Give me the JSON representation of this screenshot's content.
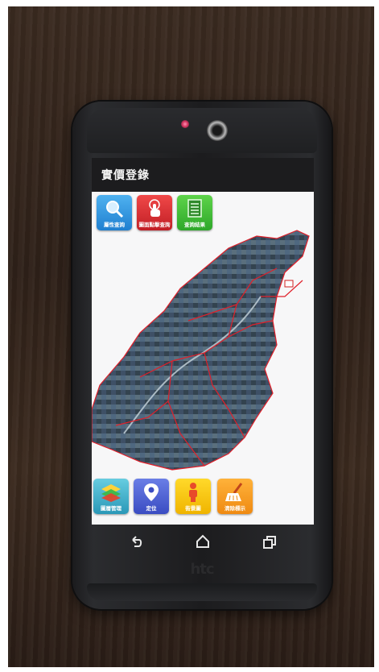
{
  "app": {
    "title": "實價登錄"
  },
  "top_buttons": [
    {
      "label": "屬性查詢",
      "icon": "magnifier-icon",
      "color": "#2e8fdf"
    },
    {
      "label": "圖面點擊查詢",
      "icon": "tap-hand-icon",
      "color": "#d62a30"
    },
    {
      "label": "查詢結果",
      "icon": "list-document-icon",
      "color": "#3fbf36"
    }
  ],
  "bottom_buttons": [
    {
      "label": "圖層管理",
      "icon": "layers-icon",
      "color": "#3fb0cc"
    },
    {
      "label": "定位",
      "icon": "map-pin-icon",
      "color": "#4a5fd6"
    },
    {
      "label": "街景圖",
      "icon": "street-view-person-icon",
      "color": "#f5c400"
    },
    {
      "label": "清除標示",
      "icon": "broom-icon",
      "color": "#f59a20"
    }
  ],
  "nav": {
    "back": "back-icon",
    "home": "home-icon",
    "recents": "recents-icon"
  },
  "phone_brand": "htc"
}
